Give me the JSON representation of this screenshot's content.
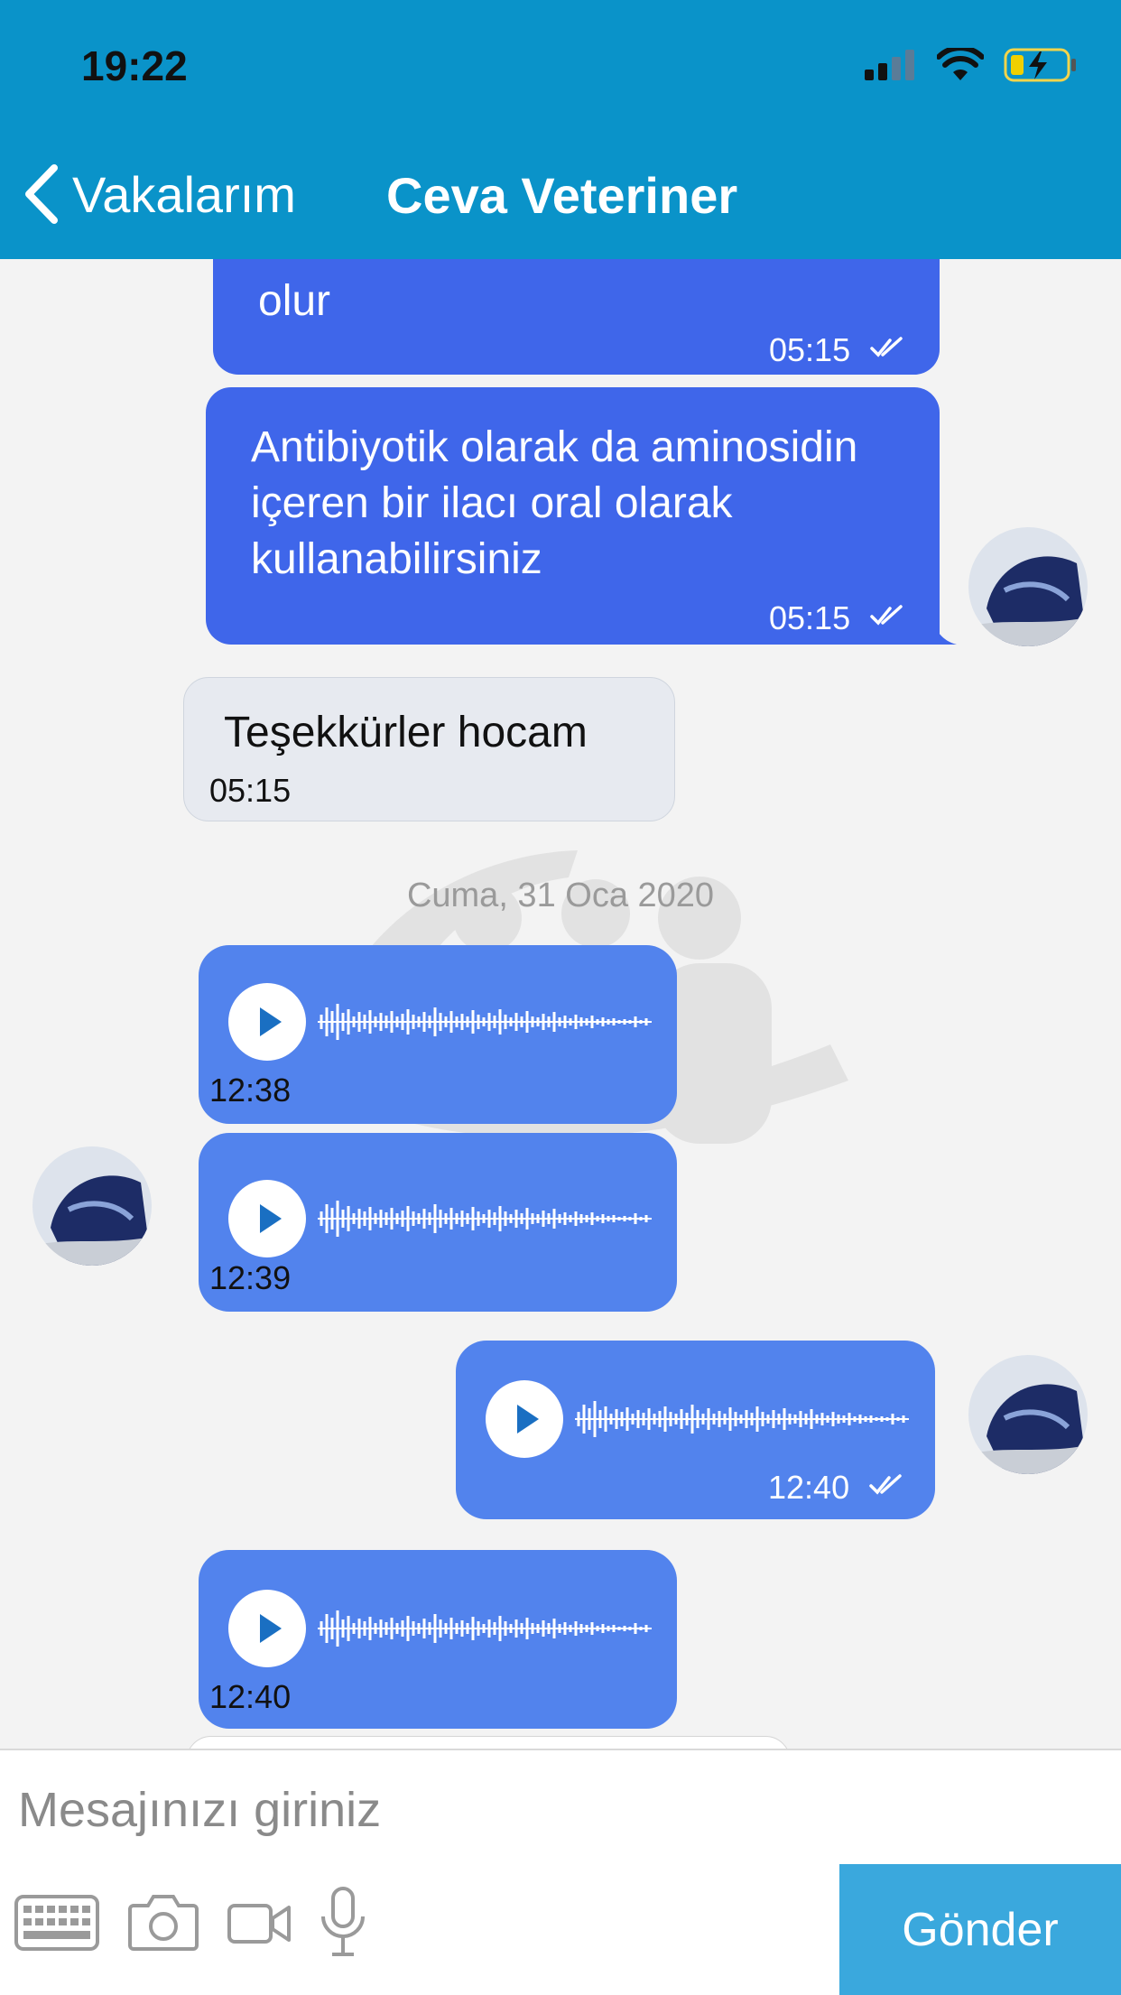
{
  "status_bar": {
    "time": "19:22"
  },
  "nav": {
    "back_label": "Vakalarım",
    "title": "Ceva Veteriner"
  },
  "messages": [
    {
      "type": "text",
      "direction": "out",
      "text": "olur",
      "time": "05:15"
    },
    {
      "type": "text",
      "direction": "out",
      "text": "Antibiyotik olarak da aminosidin içeren bir ilacı oral olarak kullanabilirsiniz",
      "time": "05:15"
    },
    {
      "type": "text",
      "direction": "in",
      "text": "Teşekkürler hocam",
      "time": "05:15"
    },
    {
      "type": "date",
      "text": "Cuma, 31 Oca 2020"
    },
    {
      "type": "audio",
      "direction": "in",
      "time": "12:38"
    },
    {
      "type": "audio",
      "direction": "in",
      "time": "12:39"
    },
    {
      "type": "audio",
      "direction": "out",
      "time": "12:40"
    },
    {
      "type": "audio",
      "direction": "in",
      "time": "12:40"
    }
  ],
  "composer": {
    "placeholder": "Mesajınızı giriniz",
    "send_label": "Gönder"
  },
  "colors": {
    "header": "#0a93c9",
    "outgoing_bubble": "#3f66ea",
    "audio_bubble": "#5283ed",
    "incoming_bubble": "#e7eaf0",
    "send_button": "#3aa8dd"
  }
}
